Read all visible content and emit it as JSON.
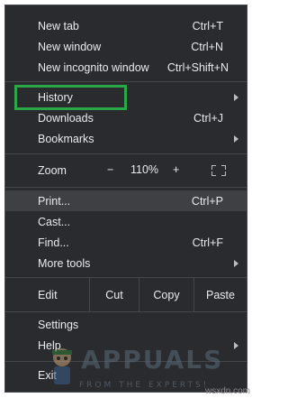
{
  "menu": {
    "new_tab": {
      "label": "New tab",
      "shortcut": "Ctrl+T"
    },
    "new_window": {
      "label": "New window",
      "shortcut": "Ctrl+N"
    },
    "new_incognito": {
      "label": "New incognito window",
      "shortcut": "Ctrl+Shift+N"
    },
    "history": {
      "label": "History"
    },
    "downloads": {
      "label": "Downloads",
      "shortcut": "Ctrl+J"
    },
    "bookmarks": {
      "label": "Bookmarks"
    },
    "zoom": {
      "label": "Zoom",
      "minus": "−",
      "level": "110%",
      "plus": "+"
    },
    "print": {
      "label": "Print...",
      "shortcut": "Ctrl+P"
    },
    "cast": {
      "label": "Cast..."
    },
    "find": {
      "label": "Find...",
      "shortcut": "Ctrl+F"
    },
    "more_tools": {
      "label": "More tools"
    },
    "edit": {
      "label": "Edit",
      "cut": "Cut",
      "copy": "Copy",
      "paste": "Paste"
    },
    "settings": {
      "label": "Settings"
    },
    "help": {
      "label": "Help"
    },
    "exit": {
      "label": "Exit"
    }
  },
  "watermark": {
    "brand": "APPUALS",
    "tagline": "FROM THE EXPERTS!",
    "site": "wsxdn.com"
  },
  "colors": {
    "menu_bg": "#2a2b2e",
    "highlight_box": "#2aa847",
    "hover_row": "#3f4043"
  }
}
